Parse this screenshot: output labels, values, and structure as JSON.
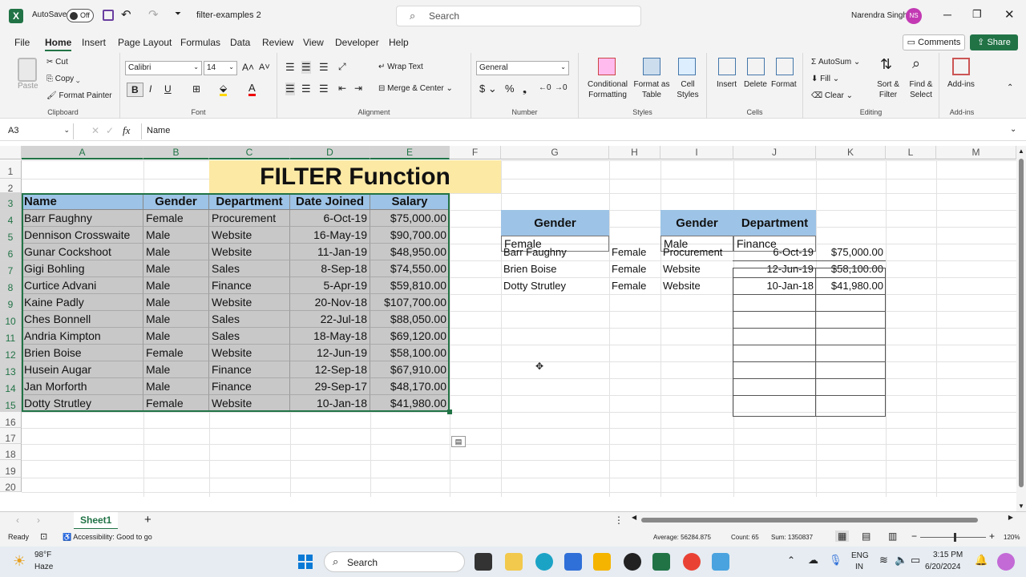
{
  "titlebar": {
    "autosave_label": "AutoSave",
    "autosave_state": "Off",
    "doc_title": "filter-examples 2",
    "search_placeholder": "Search",
    "user_name": "Narendra Singh",
    "user_initials": "NS"
  },
  "menu": [
    "File",
    "Home",
    "Insert",
    "Page Layout",
    "Formulas",
    "Data",
    "Review",
    "View",
    "Developer",
    "Help"
  ],
  "menu_active": "Home",
  "comments_label": "Comments",
  "share_label": "Share",
  "ribbon": {
    "clipboard": {
      "paste": "Paste",
      "cut": "Cut",
      "copy": "Copy",
      "format_painter": "Format Painter",
      "label": "Clipboard"
    },
    "font": {
      "name": "Calibri",
      "size": "14",
      "label": "Font"
    },
    "alignment": {
      "wrap": "Wrap Text",
      "merge": "Merge & Center",
      "label": "Alignment"
    },
    "number": {
      "format": "General",
      "label": "Number"
    },
    "styles": {
      "cond": "Conditional Formatting",
      "fmt_table": "Format as Table",
      "cell_styles": "Cell Styles",
      "label": "Styles"
    },
    "cells": {
      "insert": "Insert",
      "delete": "Delete",
      "format": "Format",
      "label": "Cells"
    },
    "editing": {
      "autosum": "AutoSum",
      "fill": "Fill",
      "clear": "Clear",
      "sort": "Sort & Filter",
      "find": "Find & Select",
      "label": "Editing"
    },
    "addins": {
      "addins": "Add-ins",
      "label": "Add-ins"
    }
  },
  "formula": {
    "namebox": "A3",
    "content": "Name"
  },
  "columns": [
    "A",
    "B",
    "C",
    "D",
    "E",
    "F",
    "G",
    "H",
    "I",
    "J",
    "K",
    "L",
    "M"
  ],
  "rows": [
    "1",
    "2",
    "3",
    "4",
    "5",
    "6",
    "7",
    "8",
    "9",
    "10",
    "11",
    "12",
    "13",
    "14",
    "15",
    "16",
    "17",
    "18",
    "19",
    "20"
  ],
  "title_cell": "FILTER Function",
  "table": {
    "headers": [
      "Name",
      "Gender",
      "Department",
      "Date Joined",
      "Salary"
    ],
    "rows": [
      [
        "Barr Faughny",
        "Female",
        "Procurement",
        "6-Oct-19",
        "$75,000.00"
      ],
      [
        "Dennison Crosswaite",
        "Male",
        "Website",
        "16-May-19",
        "$90,700.00"
      ],
      [
        "Gunar Cockshoot",
        "Male",
        "Website",
        "11-Jan-19",
        "$48,950.00"
      ],
      [
        "Gigi Bohling",
        "Male",
        "Sales",
        "8-Sep-18",
        "$74,550.00"
      ],
      [
        "Curtice Advani",
        "Male",
        "Finance",
        "5-Apr-19",
        "$59,810.00"
      ],
      [
        "Kaine Padly",
        "Male",
        "Website",
        "20-Nov-18",
        "$107,700.00"
      ],
      [
        "Ches Bonnell",
        "Male",
        "Sales",
        "22-Jul-18",
        "$88,050.00"
      ],
      [
        "Andria Kimpton",
        "Male",
        "Sales",
        "18-May-18",
        "$69,120.00"
      ],
      [
        "Brien Boise",
        "Female",
        "Website",
        "12-Jun-19",
        "$58,100.00"
      ],
      [
        "Husein Augar",
        "Male",
        "Finance",
        "12-Sep-18",
        "$67,910.00"
      ],
      [
        "Jan Morforth",
        "Male",
        "Finance",
        "29-Sep-17",
        "$48,170.00"
      ],
      [
        "Dotty Strutley",
        "Female",
        "Website",
        "10-Jan-18",
        "$41,980.00"
      ]
    ]
  },
  "criteria1": {
    "header": "Gender",
    "value": "Female"
  },
  "criteria2": {
    "headers": [
      "Gender",
      "Department"
    ],
    "values": [
      "Male",
      "Finance"
    ]
  },
  "results": [
    [
      "Barr Faughny",
      "Female",
      "Procurement",
      "6-Oct-19",
      "$75,000.00"
    ],
    [
      "Brien Boise",
      "Female",
      "Website",
      "12-Jun-19",
      "$58,100.00"
    ],
    [
      "Dotty Strutley",
      "Female",
      "Website",
      "10-Jan-18",
      "$41,980.00"
    ]
  ],
  "sheet_tab": "Sheet1",
  "status": {
    "ready": "Ready",
    "accessibility": "Accessibility: Good to go",
    "average": "Average: 56284.875",
    "count": "Count: 65",
    "sum": "Sum: 1350837",
    "zoom": "120%"
  },
  "taskbar": {
    "temp": "98°F",
    "weather": "Haze",
    "search": "Search",
    "lang1": "ENG",
    "lang2": "IN",
    "time": "3:15 PM",
    "date": "6/20/2024"
  },
  "colors": {
    "excel_green": "#217346",
    "header_blue": "#9dc3e6",
    "title_yellow": "#fce9a4",
    "selection_gray": "#c8c8c8"
  }
}
